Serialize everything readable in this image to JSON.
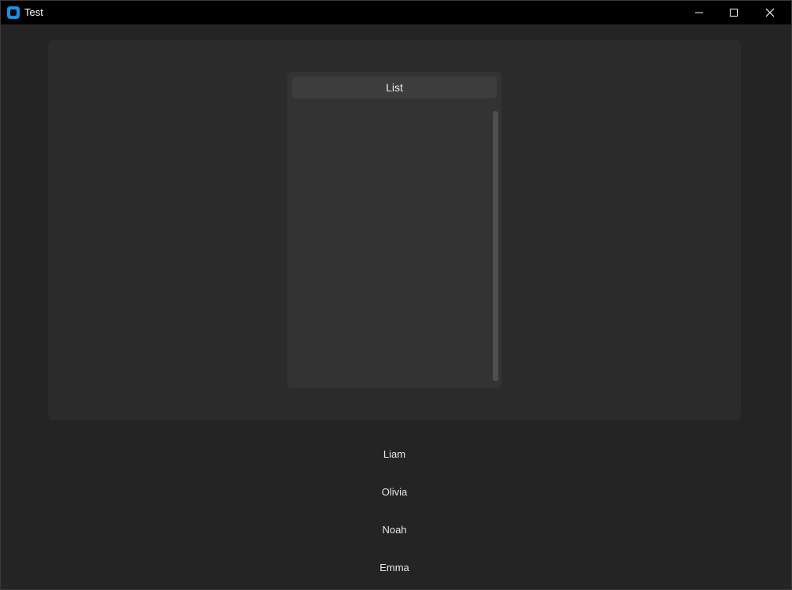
{
  "window": {
    "title": "Test"
  },
  "title_controls": {
    "minimize": "minimize",
    "maximize": "maximize",
    "close": "close"
  },
  "list": {
    "header": "List"
  },
  "names": [
    "Liam",
    "Olivia",
    "Noah",
    "Emma"
  ],
  "colors": {
    "titlebar": "#000000",
    "background": "#242424",
    "panel": "#2b2b2b",
    "list_frame": "#333333",
    "list_header": "#3d3d3d",
    "accent_icon": "#1b8ee6",
    "text": "#e6e6e6"
  },
  "icons": {
    "app": "app-icon",
    "minimize": "minimize-icon",
    "maximize": "maximize-icon",
    "close": "close-icon"
  }
}
